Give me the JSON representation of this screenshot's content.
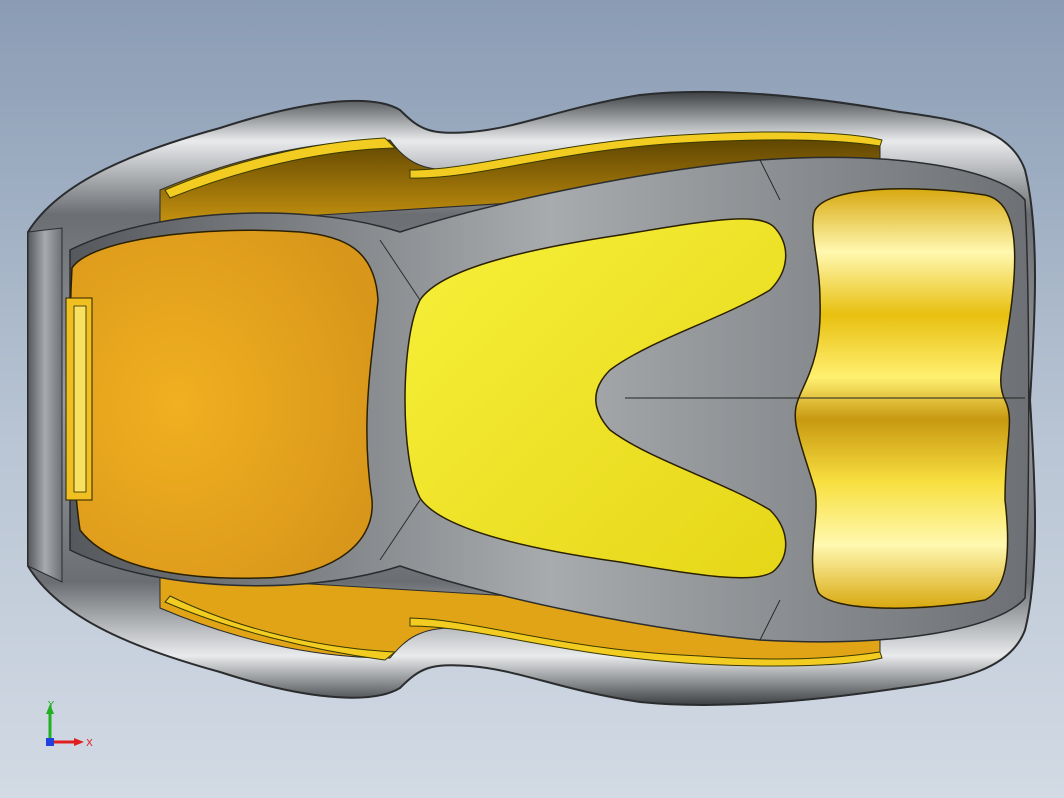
{
  "viewport": {
    "background_top": "#8a9cb4",
    "background_bottom": "#d2dae4"
  },
  "model": {
    "shell_color": "#8d9093",
    "surface_color": "#f0d000",
    "pocket_color": "#e8a81c"
  },
  "triad": {
    "x_label": "X",
    "y_label": "Y",
    "x_color": "#e02020",
    "y_color": "#20b020",
    "z_color": "#2040e0"
  }
}
